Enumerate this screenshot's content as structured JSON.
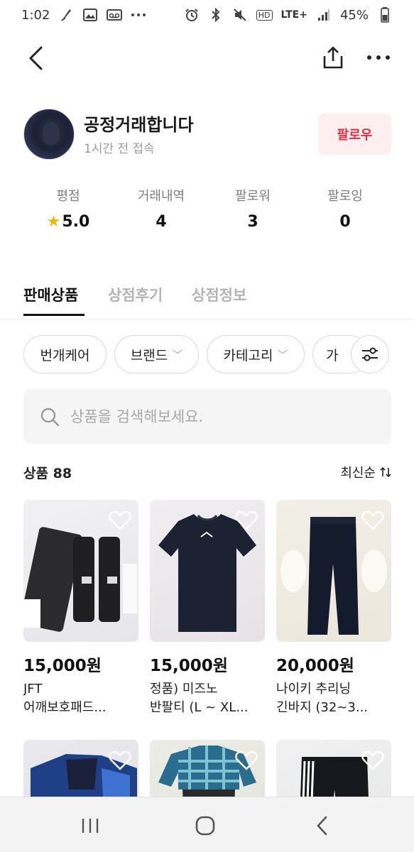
{
  "status_bar": {
    "time": "1:02",
    "battery": "45%",
    "network": "LTE+",
    "hd_label": "HD"
  },
  "profile": {
    "name": "공정거래합니다",
    "last_active": "1시간 전 접속",
    "follow_label": "팔로우"
  },
  "stats": [
    {
      "label": "평점",
      "value": "5.0",
      "icon": "star-icon"
    },
    {
      "label": "거래내역",
      "value": "4"
    },
    {
      "label": "팔로워",
      "value": "3"
    },
    {
      "label": "팔로잉",
      "value": "0"
    }
  ],
  "tabs": [
    {
      "label": "판매상품",
      "active": true
    },
    {
      "label": "상점후기",
      "active": false
    },
    {
      "label": "상점정보",
      "active": false
    }
  ],
  "filters": [
    {
      "label": "번개케어"
    },
    {
      "label": "브랜드"
    },
    {
      "label": "카테고리"
    },
    {
      "label": "가"
    }
  ],
  "search": {
    "placeholder": "상품을 검색해보세요."
  },
  "listing": {
    "count_label": "상품",
    "count": "88",
    "sort_label": "최신순"
  },
  "products": [
    {
      "price": "15,000원",
      "title_line1": "JFT",
      "title_line2": "어깨보호패드..."
    },
    {
      "price": "15,000원",
      "title_line1": "정품) 미즈노",
      "title_line2": "반팔티 (L ~ XL..."
    },
    {
      "price": "20,000원",
      "title_line1": "나이키 추리닝",
      "title_line2": "긴바지 (32~3..."
    },
    {
      "price": "",
      "title_line1": "",
      "title_line2": ""
    },
    {
      "price": "",
      "title_line1": "",
      "title_line2": ""
    },
    {
      "price": "",
      "title_line1": "",
      "title_line2": ""
    }
  ],
  "colors": {
    "accent_red": "#e03047",
    "follow_bg": "#fdeef0",
    "star": "#f5b400",
    "muted_text": "#9a9a9a"
  }
}
